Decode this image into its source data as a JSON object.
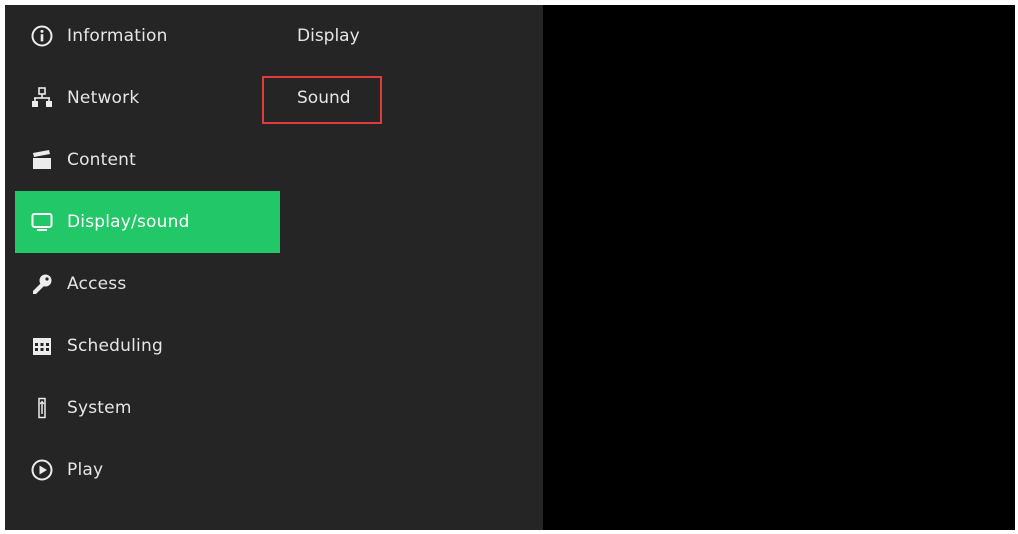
{
  "main_menu": {
    "items": [
      {
        "label": "Information",
        "icon": "info-icon"
      },
      {
        "label": "Network",
        "icon": "network-icon"
      },
      {
        "label": "Content",
        "icon": "clapperboard-icon"
      },
      {
        "label": "Display/sound",
        "icon": "monitor-icon",
        "active": true
      },
      {
        "label": "Access",
        "icon": "key-icon"
      },
      {
        "label": "Scheduling",
        "icon": "calendar-icon"
      },
      {
        "label": "System",
        "icon": "thermometer-icon"
      },
      {
        "label": "Play",
        "icon": "play-icon"
      }
    ]
  },
  "sub_menu": {
    "items": [
      {
        "label": "Display"
      },
      {
        "label": "Sound",
        "highlighted": true
      }
    ]
  },
  "colors": {
    "active_bg": "#22c767",
    "highlight_border": "#e23b3b",
    "panel_bg": "#252525",
    "content_bg": "#000000"
  }
}
